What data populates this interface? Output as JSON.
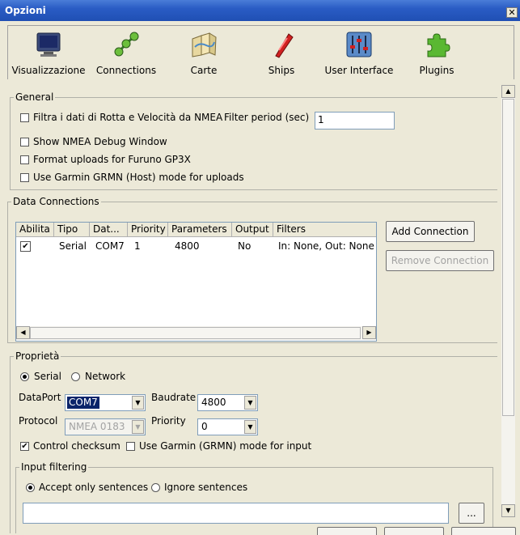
{
  "window": {
    "title": "Opzioni",
    "close": "✕"
  },
  "toolbar": {
    "items": [
      {
        "label": "Visualizzazione",
        "icon": "monitor-icon"
      },
      {
        "label": "Connections",
        "icon": "connections-icon"
      },
      {
        "label": "Carte",
        "icon": "charts-icon"
      },
      {
        "label": "Ships",
        "icon": "ship-icon"
      },
      {
        "label": "User Interface",
        "icon": "sliders-icon"
      },
      {
        "label": "Plugins",
        "icon": "puzzle-icon"
      }
    ]
  },
  "general": {
    "legend": "General",
    "filter_label": "Filtra i dati di Rotta e Velocità da NMEA",
    "filter_checked": false,
    "filter_period_label": "Filter period (sec)",
    "filter_period_value": "1",
    "show_debug_label": "Show NMEA Debug Window",
    "show_debug_checked": false,
    "furuno_label": "Format uploads for Furuno GP3X",
    "furuno_checked": false,
    "garmin_label": "Use Garmin GRMN (Host) mode for uploads",
    "garmin_checked": false
  },
  "data_connections": {
    "legend": "Data Connections",
    "columns": [
      "Abilita",
      "Tipo",
      "Dat...",
      "Priority",
      "Parameters",
      "Output",
      "Filters"
    ],
    "rows": [
      {
        "enabled": "✔",
        "type": "Serial",
        "data": "COM7",
        "priority": "1",
        "parameters": "4800",
        "output": "No",
        "filters": "In: None, Out: None"
      }
    ],
    "add_button": "Add Connection",
    "remove_button": "Remove Connection"
  },
  "properties": {
    "legend": "Proprietà",
    "serial_label": "Serial",
    "network_label": "Network",
    "dataport_label": "DataPort",
    "dataport_value": "COM7",
    "baudrate_label": "Baudrate",
    "baudrate_value": "4800",
    "protocol_label": "Protocol",
    "protocol_value": "NMEA 0183",
    "priority_label": "Priority",
    "priority_value": "0",
    "checksum_label": "Control checksum",
    "checksum_checked": true,
    "garmin_input_label": "Use Garmin (GRMN) mode for input",
    "garmin_input_checked": false
  },
  "input_filtering": {
    "legend": "Input filtering",
    "accept_label": "Accept only sentences",
    "ignore_label": "Ignore sentences",
    "sentences_value": "",
    "browse_button": "..."
  },
  "scroll": {
    "up": "▲",
    "down": "▼",
    "left": "◀",
    "right": "▶"
  }
}
